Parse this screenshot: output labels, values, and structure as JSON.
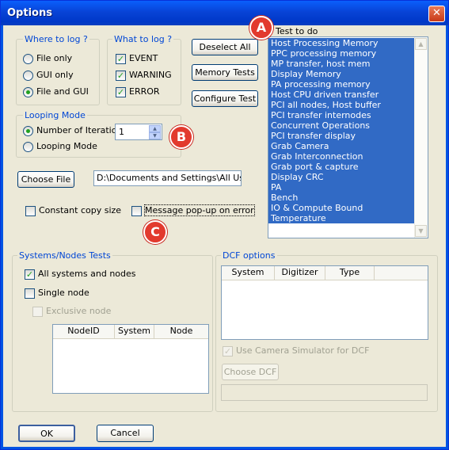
{
  "window": {
    "title": "Options",
    "close_glyph": "✕"
  },
  "where_to_log": {
    "legend": "Where to log ?",
    "options": [
      "File only",
      "GUI only",
      "File and GUI"
    ],
    "selected": "File and GUI"
  },
  "what_to_log": {
    "legend": "What to log ?",
    "options": [
      {
        "label": "EVENT",
        "checked": true
      },
      {
        "label": "WARNING",
        "checked": true
      },
      {
        "label": "ERROR",
        "checked": true
      }
    ]
  },
  "buttons": {
    "deselect_all": "Deselect All",
    "memory_tests": "Memory Tests",
    "configure_test": "Configure Test",
    "choose_file": "Choose File",
    "ok": "OK",
    "cancel": "Cancel",
    "choose_dcf": "Choose DCF"
  },
  "looping_mode": {
    "legend": "Looping Mode",
    "options": [
      "Number of Iteration",
      "Looping Mode"
    ],
    "selected": "Number of Iteration",
    "iterations": "1"
  },
  "file_path": "D:\\Documents and Settings\\All Users",
  "constant_copy_size": {
    "label": "Constant copy size",
    "checked": false
  },
  "message_popup": {
    "label": "Message pop-up on error",
    "checked": false
  },
  "test_to_do": {
    "label": "Test to do",
    "items": [
      "Host Processing Memory",
      "PPC processing memory",
      "MP transfer, host mem",
      "Display Memory",
      "PA processing memory",
      "Host CPU driven transfer",
      "PCI all nodes, Host buffer",
      "PCI transfer internodes",
      "Concurrent Operations",
      "PCI transfer display",
      "Grab Camera",
      "Grab Interconnection",
      "Grab port & capture",
      "Display CRC",
      "PA",
      "Bench",
      "IO & Compute Bound",
      "Temperature"
    ]
  },
  "systems_nodes": {
    "legend": "Systems/Nodes Tests",
    "all_systems": {
      "label": "All systems and nodes",
      "checked": true
    },
    "single_node": {
      "label": "Single node",
      "checked": false
    },
    "exclusive_node": {
      "label": "Exclusive node",
      "checked": false,
      "disabled": true
    },
    "columns": [
      "NodeID",
      "System",
      "Node"
    ]
  },
  "dcf_options": {
    "legend": "DCF options",
    "columns": [
      "System",
      "Digitizer",
      "Type"
    ],
    "use_camera_simulator": {
      "label": "Use Camera Simulator for DCF",
      "checked": true,
      "disabled": true
    },
    "dcf_path": ""
  },
  "markers": {
    "a": "A",
    "b": "B",
    "c": "C"
  },
  "colors": {
    "title_bar": "#0054e3",
    "selection": "#316ac5",
    "marker": "#e23a2e",
    "group_legend": "#0046d5",
    "dialog_bg": "#ece9d8"
  }
}
